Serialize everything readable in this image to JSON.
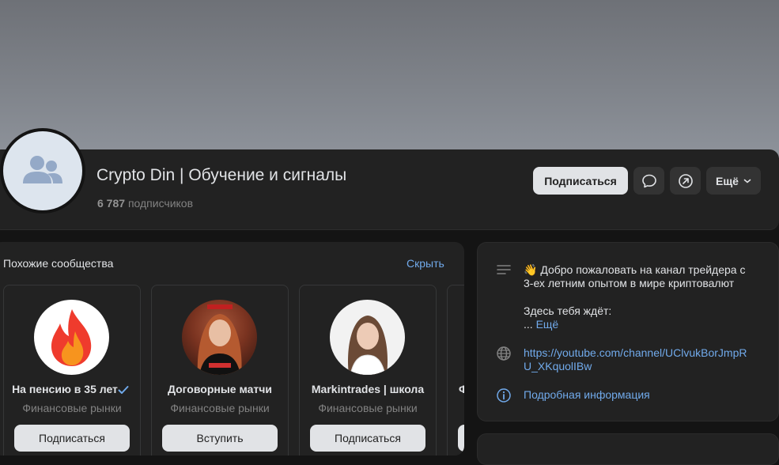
{
  "community": {
    "title": "Crypto Din | Обучение и сигналы",
    "subscribers_count": "6 787",
    "subscribers_label": "подписчиков"
  },
  "header": {
    "subscribe_label": "Подписаться",
    "more_label": "Ещё"
  },
  "similar": {
    "title": "Похожие сообщества",
    "hide_label": "Скрыть",
    "items": [
      {
        "name": "На пенсию в 35 лет",
        "category": "Финансовые рынки",
        "button": "Подписаться"
      },
      {
        "name": "Договорные матчи",
        "category": "Финансовые рынки",
        "button": "Вступить"
      },
      {
        "name": "Markintrades | школа",
        "category": "Финансовые рынки",
        "button": "Подписаться"
      },
      {
        "name": "Ф"
      }
    ]
  },
  "info": {
    "welcome_line1": "👋 Добро пожаловать на канал трейдера с",
    "welcome_line2": "3-ех летним опытом в мире криптовалют",
    "waiting": "Здесь тебя ждёт:",
    "ellipsis": "...",
    "more_label": "Ещё",
    "link_line1": "https://youtube.com/channel/UClvukBorJmpR",
    "link_line2": "U_XKquolIBw",
    "details_label": "Подробная информация"
  }
}
